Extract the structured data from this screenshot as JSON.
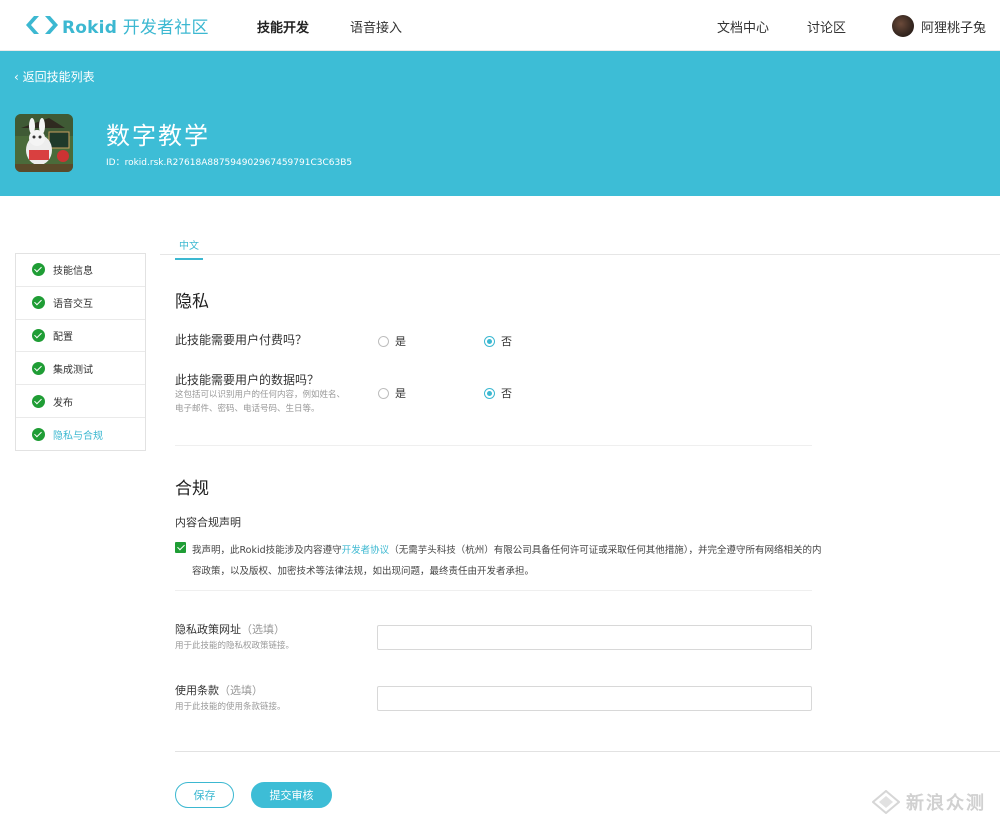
{
  "nav": {
    "brand_en": "Rokid",
    "brand_cn": "开发者社区",
    "items": [
      {
        "label": "技能开发",
        "active": true
      },
      {
        "label": "语音接入",
        "active": false
      }
    ],
    "right_items": [
      {
        "label": "文档中心"
      },
      {
        "label": "讨论区"
      }
    ],
    "user_name": "阿狸桃子兔"
  },
  "banner": {
    "back_label": "返回技能列表",
    "title": "数字教学",
    "id_text": "ID：rokid.rsk.R27618A887594902967459791C3C63B5"
  },
  "sidebar": {
    "items": [
      {
        "label": "技能信息",
        "done": true,
        "active": false
      },
      {
        "label": "语音交互",
        "done": true,
        "active": false
      },
      {
        "label": "配置",
        "done": true,
        "active": false
      },
      {
        "label": "集成测试",
        "done": true,
        "active": false
      },
      {
        "label": "发布",
        "done": true,
        "active": false
      },
      {
        "label": "隐私与合规",
        "done": true,
        "active": true
      }
    ]
  },
  "tabs": [
    {
      "label": "中文",
      "active": true
    }
  ],
  "privacy": {
    "heading": "隐私",
    "q1": {
      "label": "此技能需要用户付费吗？",
      "options": [
        "是",
        "否"
      ],
      "selected": "否"
    },
    "q2": {
      "label": "此技能需要用户的数据吗？",
      "help": "这包括可以识别用户的任何内容，例如姓名、电子邮件、密码、电话号码、生日等。",
      "options": [
        "是",
        "否"
      ],
      "selected": "否"
    }
  },
  "compliance": {
    "heading": "合规",
    "sub_title": "内容合规声明",
    "checked": true,
    "declaration_before": "我声明，此Rokid技能涉及内容遵守",
    "declaration_link": "开发者协议",
    "declaration_after": "（无需芋头科技（杭州）有限公司具备任何许可证或采取任何其他措施），并完全遵守所有网络相关的内容政策，以及版权、加密技术等法律法规，如出现问题，最终责任由开发者承担。",
    "privacy_url": {
      "label": "隐私政策网址",
      "optional": "（选填）",
      "help": "用于此技能的隐私权政策链接。",
      "value": ""
    },
    "terms": {
      "label": "使用条款",
      "optional": "（选填）",
      "help": "用于此技能的使用条款链接。",
      "value": ""
    }
  },
  "buttons": {
    "save": "保存",
    "submit": "提交审核"
  },
  "watermark": "新浪众测",
  "colors": {
    "accent": "#3dbdd6",
    "success": "#1f9d35"
  }
}
